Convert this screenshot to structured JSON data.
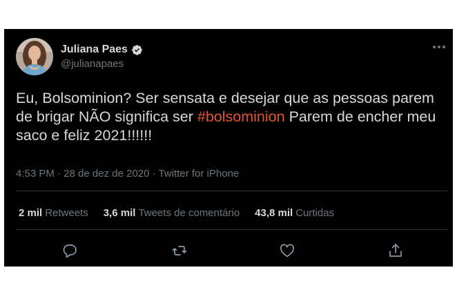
{
  "tweet": {
    "author": {
      "display_name": "Juliana Paes",
      "handle": "@julianapaes",
      "verified": true
    },
    "text_parts": {
      "before": "Eu, Bolsominion? Ser sensata e desejar que as pessoas parem de brigar NÃO significa ser ",
      "hashtag": "#bolsominion",
      "after": " Parem de encher meu saco e feliz 2021!!!!!!"
    },
    "meta": "4:53 PM · 28 de dez de 2020 · Twitter for iPhone",
    "stats": [
      {
        "count": "2 mil",
        "label": "Retweets"
      },
      {
        "count": "3,6 mil",
        "label": "Tweets de comentário"
      },
      {
        "count": "43,8 mil",
        "label": "Curtidas"
      }
    ],
    "actions": [
      "reply-icon",
      "retweet-icon",
      "like-icon",
      "share-icon"
    ],
    "colors": {
      "background": "#000000",
      "text": "#d9d9d9",
      "secondary": "#6e767d",
      "hashtag": "#e0542e",
      "divider": "#2f3336"
    }
  }
}
